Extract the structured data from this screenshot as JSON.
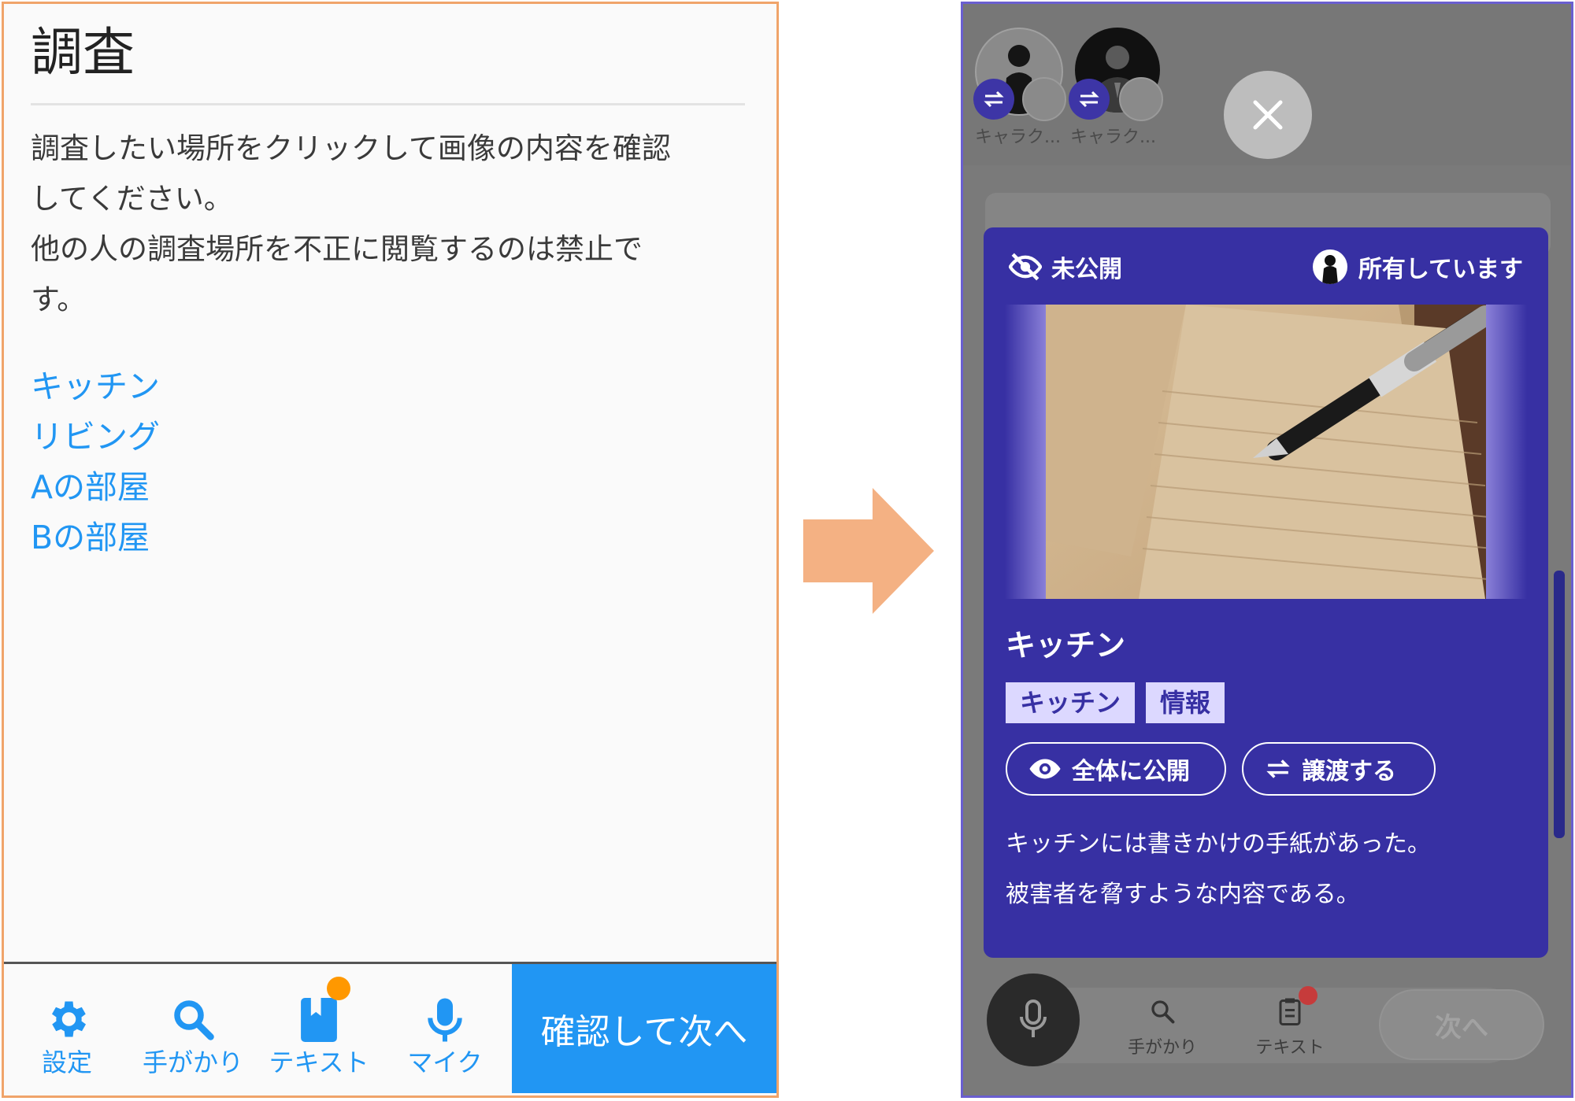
{
  "left": {
    "title": "調査",
    "description": [
      "調査したい場所をクリックして画像の内容を確認",
      "してください。",
      "他の人の調査場所を不正に閲覧するのは禁止で",
      "す。"
    ],
    "links": [
      "キッチン",
      "リビング",
      "Aの部屋",
      "Bの部屋"
    ],
    "nav": {
      "settings": "設定",
      "clues": "手がかり",
      "text": "テキスト",
      "mic": "マイク"
    },
    "confirm_next": "確認して次へ",
    "icons": [
      "gear-icon",
      "search-icon",
      "book-icon",
      "mic-icon"
    ]
  },
  "right": {
    "characters": [
      "キャラク...",
      "キャラク..."
    ],
    "card": {
      "visibility": "未公開",
      "owned": "所有しています",
      "title": "キッチン",
      "tags": [
        "キッチン",
        "情報"
      ],
      "publish_button": "全体に公開",
      "transfer_button": "譲渡する",
      "text": [
        "キッチンには書きかけの手紙があった。",
        "被害者を脅すような内容である。"
      ]
    },
    "nav": {
      "clues": "手がかり",
      "text": "テキスト"
    },
    "next": "次へ",
    "icons": [
      "close-icon",
      "eye-off-icon",
      "eye-icon",
      "swap-icon",
      "mic-icon",
      "search-icon",
      "clipboard-icon"
    ]
  },
  "colors": {
    "accent_blue": "#2196f3",
    "card_purple": "#3730a3",
    "arrow_orange": "#f4b183",
    "badge_orange": "#ff9800",
    "badge_red": "#c63b3b"
  }
}
